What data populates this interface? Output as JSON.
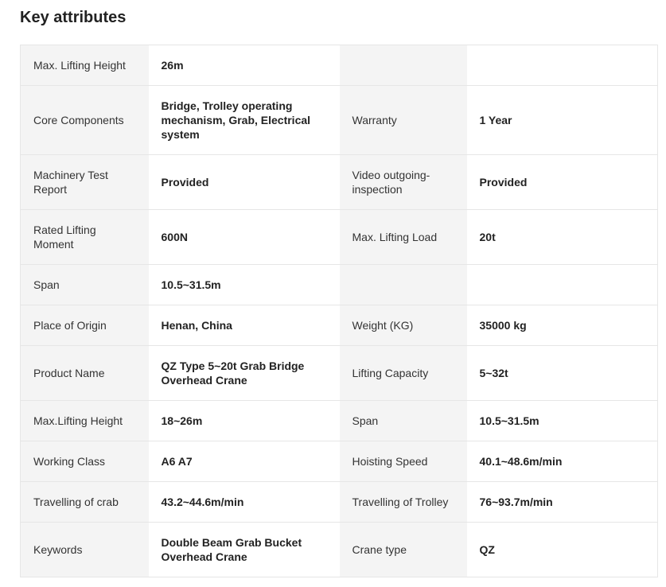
{
  "section": {
    "title": "Key attributes"
  },
  "rows": [
    {
      "k1": "Max. Lifting Height",
      "v1": "26m",
      "k2": "",
      "v2": ""
    },
    {
      "k1": "Core Components",
      "v1": "Bridge, Trolley operating mechanism, Grab, Electrical system",
      "k2": "Warranty",
      "v2": "1 Year"
    },
    {
      "k1": "Machinery Test Report",
      "v1": "Provided",
      "k2": "Video outgoing-inspection",
      "v2": "Provided"
    },
    {
      "k1": "Rated Lifting Moment",
      "v1": "600N",
      "k2": "Max. Lifting Load",
      "v2": "20t"
    },
    {
      "k1": "Span",
      "v1": "10.5~31.5m",
      "k2": "",
      "v2": ""
    },
    {
      "k1": "Place of Origin",
      "v1": "Henan, China",
      "k2": "Weight (KG)",
      "v2": "35000 kg"
    },
    {
      "k1": "Product Name",
      "v1": "QZ Type 5~20t Grab Bridge Overhead Crane",
      "k2": "Lifting Capacity",
      "v2": "5~32t"
    },
    {
      "k1": "Max.Lifting Height",
      "v1": "18~26m",
      "k2": "Span",
      "v2": "10.5~31.5m"
    },
    {
      "k1": "Working Class",
      "v1": "A6 A7",
      "k2": "Hoisting Speed",
      "v2": "40.1~48.6m/min"
    },
    {
      "k1": "Travelling of crab",
      "v1": "43.2~44.6m/min",
      "k2": "Travelling of Trolley",
      "v2": "76~93.7m/min"
    },
    {
      "k1": "Keywords",
      "v1": "Double Beam Grab Bucket Overhead Crane",
      "k2": "Crane type",
      "v2": "QZ"
    }
  ]
}
